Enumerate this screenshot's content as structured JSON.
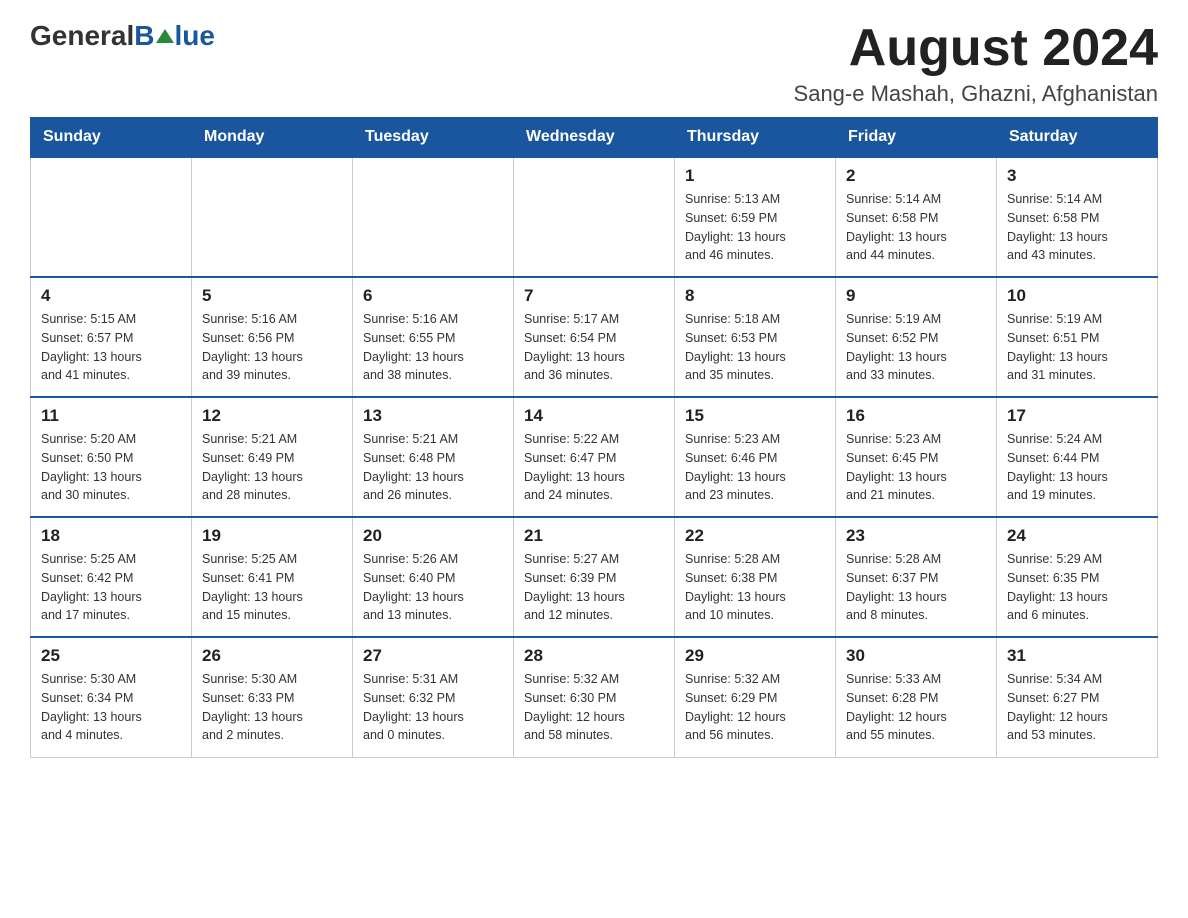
{
  "header": {
    "logo_general": "General",
    "logo_blue": "Blue",
    "month_title": "August 2024",
    "location": "Sang-e Mashah, Ghazni, Afghanistan"
  },
  "days_of_week": [
    "Sunday",
    "Monday",
    "Tuesday",
    "Wednesday",
    "Thursday",
    "Friday",
    "Saturday"
  ],
  "weeks": [
    {
      "days": [
        {
          "number": "",
          "info": ""
        },
        {
          "number": "",
          "info": ""
        },
        {
          "number": "",
          "info": ""
        },
        {
          "number": "",
          "info": ""
        },
        {
          "number": "1",
          "info": "Sunrise: 5:13 AM\nSunset: 6:59 PM\nDaylight: 13 hours\nand 46 minutes."
        },
        {
          "number": "2",
          "info": "Sunrise: 5:14 AM\nSunset: 6:58 PM\nDaylight: 13 hours\nand 44 minutes."
        },
        {
          "number": "3",
          "info": "Sunrise: 5:14 AM\nSunset: 6:58 PM\nDaylight: 13 hours\nand 43 minutes."
        }
      ]
    },
    {
      "days": [
        {
          "number": "4",
          "info": "Sunrise: 5:15 AM\nSunset: 6:57 PM\nDaylight: 13 hours\nand 41 minutes."
        },
        {
          "number": "5",
          "info": "Sunrise: 5:16 AM\nSunset: 6:56 PM\nDaylight: 13 hours\nand 39 minutes."
        },
        {
          "number": "6",
          "info": "Sunrise: 5:16 AM\nSunset: 6:55 PM\nDaylight: 13 hours\nand 38 minutes."
        },
        {
          "number": "7",
          "info": "Sunrise: 5:17 AM\nSunset: 6:54 PM\nDaylight: 13 hours\nand 36 minutes."
        },
        {
          "number": "8",
          "info": "Sunrise: 5:18 AM\nSunset: 6:53 PM\nDaylight: 13 hours\nand 35 minutes."
        },
        {
          "number": "9",
          "info": "Sunrise: 5:19 AM\nSunset: 6:52 PM\nDaylight: 13 hours\nand 33 minutes."
        },
        {
          "number": "10",
          "info": "Sunrise: 5:19 AM\nSunset: 6:51 PM\nDaylight: 13 hours\nand 31 minutes."
        }
      ]
    },
    {
      "days": [
        {
          "number": "11",
          "info": "Sunrise: 5:20 AM\nSunset: 6:50 PM\nDaylight: 13 hours\nand 30 minutes."
        },
        {
          "number": "12",
          "info": "Sunrise: 5:21 AM\nSunset: 6:49 PM\nDaylight: 13 hours\nand 28 minutes."
        },
        {
          "number": "13",
          "info": "Sunrise: 5:21 AM\nSunset: 6:48 PM\nDaylight: 13 hours\nand 26 minutes."
        },
        {
          "number": "14",
          "info": "Sunrise: 5:22 AM\nSunset: 6:47 PM\nDaylight: 13 hours\nand 24 minutes."
        },
        {
          "number": "15",
          "info": "Sunrise: 5:23 AM\nSunset: 6:46 PM\nDaylight: 13 hours\nand 23 minutes."
        },
        {
          "number": "16",
          "info": "Sunrise: 5:23 AM\nSunset: 6:45 PM\nDaylight: 13 hours\nand 21 minutes."
        },
        {
          "number": "17",
          "info": "Sunrise: 5:24 AM\nSunset: 6:44 PM\nDaylight: 13 hours\nand 19 minutes."
        }
      ]
    },
    {
      "days": [
        {
          "number": "18",
          "info": "Sunrise: 5:25 AM\nSunset: 6:42 PM\nDaylight: 13 hours\nand 17 minutes."
        },
        {
          "number": "19",
          "info": "Sunrise: 5:25 AM\nSunset: 6:41 PM\nDaylight: 13 hours\nand 15 minutes."
        },
        {
          "number": "20",
          "info": "Sunrise: 5:26 AM\nSunset: 6:40 PM\nDaylight: 13 hours\nand 13 minutes."
        },
        {
          "number": "21",
          "info": "Sunrise: 5:27 AM\nSunset: 6:39 PM\nDaylight: 13 hours\nand 12 minutes."
        },
        {
          "number": "22",
          "info": "Sunrise: 5:28 AM\nSunset: 6:38 PM\nDaylight: 13 hours\nand 10 minutes."
        },
        {
          "number": "23",
          "info": "Sunrise: 5:28 AM\nSunset: 6:37 PM\nDaylight: 13 hours\nand 8 minutes."
        },
        {
          "number": "24",
          "info": "Sunrise: 5:29 AM\nSunset: 6:35 PM\nDaylight: 13 hours\nand 6 minutes."
        }
      ]
    },
    {
      "days": [
        {
          "number": "25",
          "info": "Sunrise: 5:30 AM\nSunset: 6:34 PM\nDaylight: 13 hours\nand 4 minutes."
        },
        {
          "number": "26",
          "info": "Sunrise: 5:30 AM\nSunset: 6:33 PM\nDaylight: 13 hours\nand 2 minutes."
        },
        {
          "number": "27",
          "info": "Sunrise: 5:31 AM\nSunset: 6:32 PM\nDaylight: 13 hours\nand 0 minutes."
        },
        {
          "number": "28",
          "info": "Sunrise: 5:32 AM\nSunset: 6:30 PM\nDaylight: 12 hours\nand 58 minutes."
        },
        {
          "number": "29",
          "info": "Sunrise: 5:32 AM\nSunset: 6:29 PM\nDaylight: 12 hours\nand 56 minutes."
        },
        {
          "number": "30",
          "info": "Sunrise: 5:33 AM\nSunset: 6:28 PM\nDaylight: 12 hours\nand 55 minutes."
        },
        {
          "number": "31",
          "info": "Sunrise: 5:34 AM\nSunset: 6:27 PM\nDaylight: 12 hours\nand 53 minutes."
        }
      ]
    }
  ]
}
